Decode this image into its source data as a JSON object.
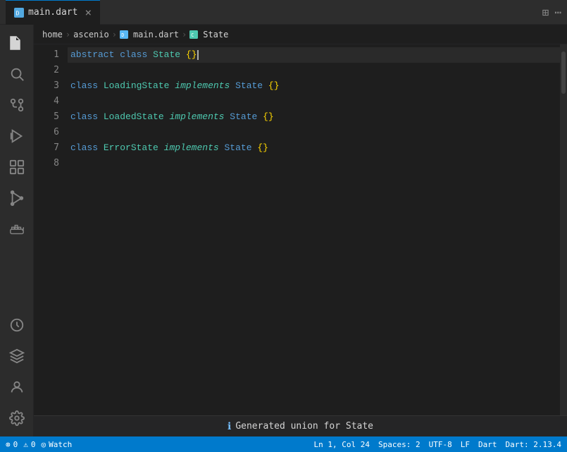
{
  "titlebar": {
    "tab_label": "main.dart",
    "tab_icon_color": "#58b7f5"
  },
  "breadcrumb": {
    "items": [
      {
        "label": "home",
        "icon": null
      },
      {
        "label": "ascenio",
        "icon": null
      },
      {
        "label": "main.dart",
        "icon": "dart"
      },
      {
        "label": "State",
        "icon": "class"
      }
    ]
  },
  "editor": {
    "lines": [
      {
        "num": 1,
        "code": "abstract class State {}",
        "active": true
      },
      {
        "num": 2,
        "code": ""
      },
      {
        "num": 3,
        "code": "class LoadingState implements State {}"
      },
      {
        "num": 4,
        "code": ""
      },
      {
        "num": 5,
        "code": "class LoadedState implements State {}"
      },
      {
        "num": 6,
        "code": ""
      },
      {
        "num": 7,
        "code": "class ErrorState implements State {}"
      },
      {
        "num": 8,
        "code": ""
      }
    ]
  },
  "notification": {
    "text": "Generated union for State"
  },
  "statusbar": {
    "errors": "0",
    "warnings": "0",
    "watch_label": "Watch",
    "position": "Ln 1, Col 24",
    "spaces": "Spaces: 2",
    "encoding": "UTF-8",
    "line_ending": "LF",
    "language": "Dart",
    "version": "Dart: 2.13.4"
  },
  "activity": {
    "icons": [
      {
        "name": "files-icon",
        "symbol": "⎘"
      },
      {
        "name": "search-icon",
        "symbol": "🔍"
      },
      {
        "name": "source-control-icon",
        "symbol": "⑂"
      },
      {
        "name": "debug-icon",
        "symbol": "🐛"
      },
      {
        "name": "extensions-icon",
        "symbol": "⧉"
      },
      {
        "name": "run-icon",
        "symbol": "▷"
      },
      {
        "name": "docker-icon",
        "symbol": "🐳"
      },
      {
        "name": "timeline-icon",
        "symbol": "⏱"
      },
      {
        "name": "remote-icon",
        "symbol": "✦"
      }
    ]
  }
}
